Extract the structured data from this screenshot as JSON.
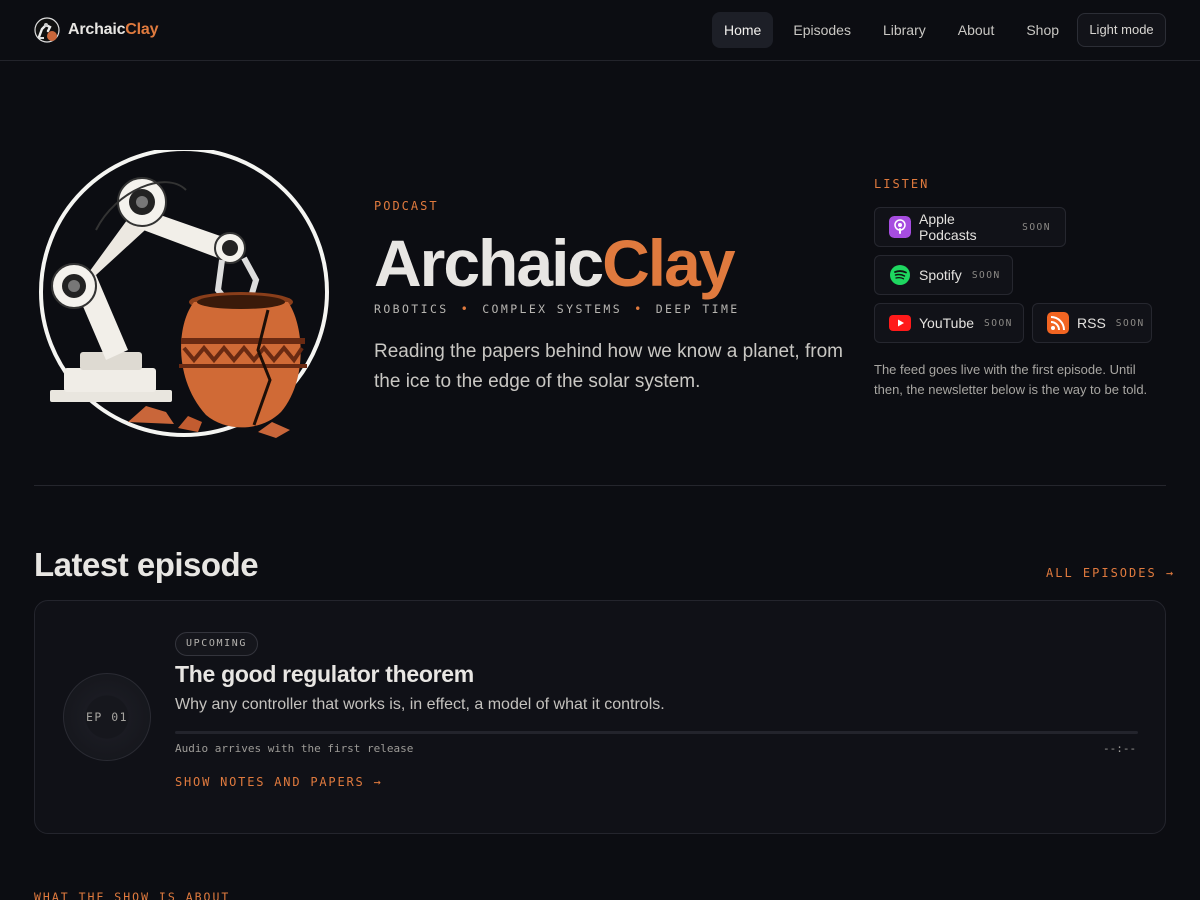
{
  "brand": {
    "name_part1": "Archaic",
    "name_part2": "Clay"
  },
  "nav": {
    "items": [
      {
        "label": "Home",
        "active": true
      },
      {
        "label": "Episodes",
        "active": false
      },
      {
        "label": "Library",
        "active": false
      },
      {
        "label": "About",
        "active": false
      },
      {
        "label": "Shop",
        "active": false
      }
    ],
    "theme_toggle": "Light mode"
  },
  "hero": {
    "kicker": "PODCAST",
    "title_part1": "Archaic",
    "title_part2": "Clay",
    "tags": [
      "ROBOTICS",
      "COMPLEX SYSTEMS",
      "DEEP TIME"
    ],
    "description": "Reading the papers behind how we know a planet, from the ice to the edge of the solar system.",
    "art_icon": "robot-arm-pottery-illustration"
  },
  "listen": {
    "kicker": "LISTEN",
    "platforms": [
      {
        "name": "Apple Podcasts",
        "status": "SOON",
        "icon": "apple-podcasts-icon"
      },
      {
        "name": "Spotify",
        "status": "SOON",
        "icon": "spotify-icon"
      },
      {
        "name": "YouTube",
        "status": "SOON",
        "icon": "youtube-icon"
      },
      {
        "name": "RSS",
        "status": "SOON",
        "icon": "rss-icon"
      }
    ],
    "note": "The feed goes live with the first episode. Until then, the newsletter below is the way to be told."
  },
  "latest": {
    "heading": "Latest episode",
    "all_link": "ALL EPISODES →",
    "episode": {
      "disc_label": "EP 01",
      "badge": "UPCOMING",
      "title": "The good regulator theorem",
      "description": "Why any controller that works is, in effect, a model of what it controls.",
      "progress": 0,
      "audio_note": "Audio arrives with the first release",
      "time": "--:--",
      "notes_link": "SHOW NOTES AND PAPERS →"
    }
  },
  "about": {
    "kicker": "WHAT THE SHOW IS ABOUT"
  },
  "colors": {
    "accent": "#e07a3e",
    "background": "#0c0d12",
    "card": "#101117"
  }
}
